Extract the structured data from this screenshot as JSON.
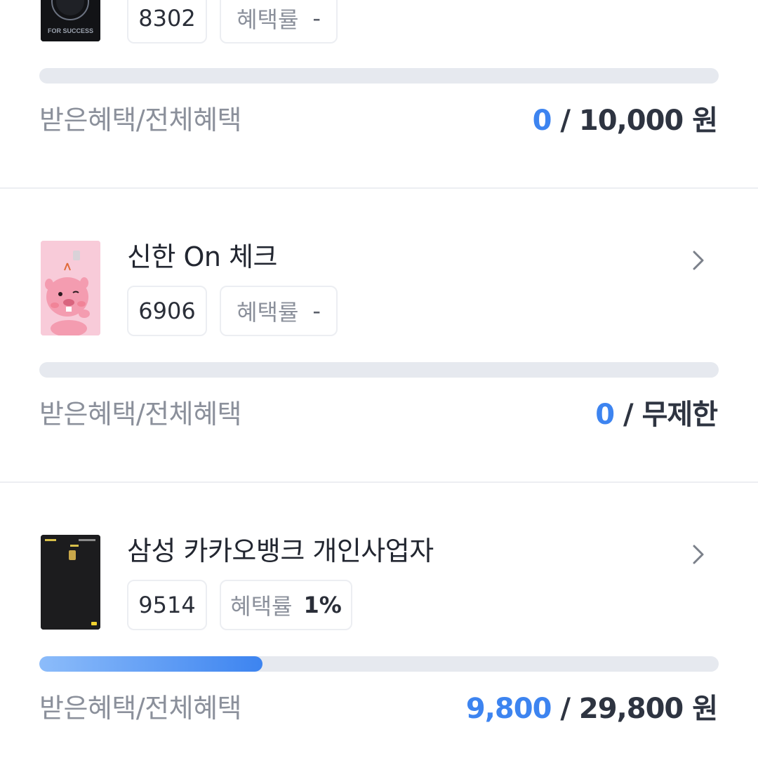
{
  "cards": [
    {
      "name": "",
      "number": "8302",
      "rate_label": "혜택률",
      "rate_value": "-",
      "benefit_label": "받은혜택/전체혜택",
      "received": "0",
      "separator": " / ",
      "total": "10,000 원",
      "progress": 0,
      "card_art_text": "FOR SUCCESS"
    },
    {
      "name": "신한 On 체크",
      "number": "6906",
      "rate_label": "혜택률",
      "rate_value": "-",
      "benefit_label": "받은혜택/전체혜택",
      "received": "0",
      "separator": " / ",
      "total": "무제한",
      "progress": 0
    },
    {
      "name": "삼성 카카오뱅크 개인사업자",
      "number": "9514",
      "rate_label": "혜택률",
      "rate_value": "1%",
      "benefit_label": "받은혜택/전체혜택",
      "received": "9,800",
      "separator": " / ",
      "total": "29,800 원",
      "progress": 0.329
    }
  ],
  "colors": {
    "accent": "#3d84f0",
    "track": "#e6e9ef",
    "label": "#8b909b",
    "value": "#2e3441"
  },
  "icons": {
    "chevron": "chevron-right-icon"
  }
}
